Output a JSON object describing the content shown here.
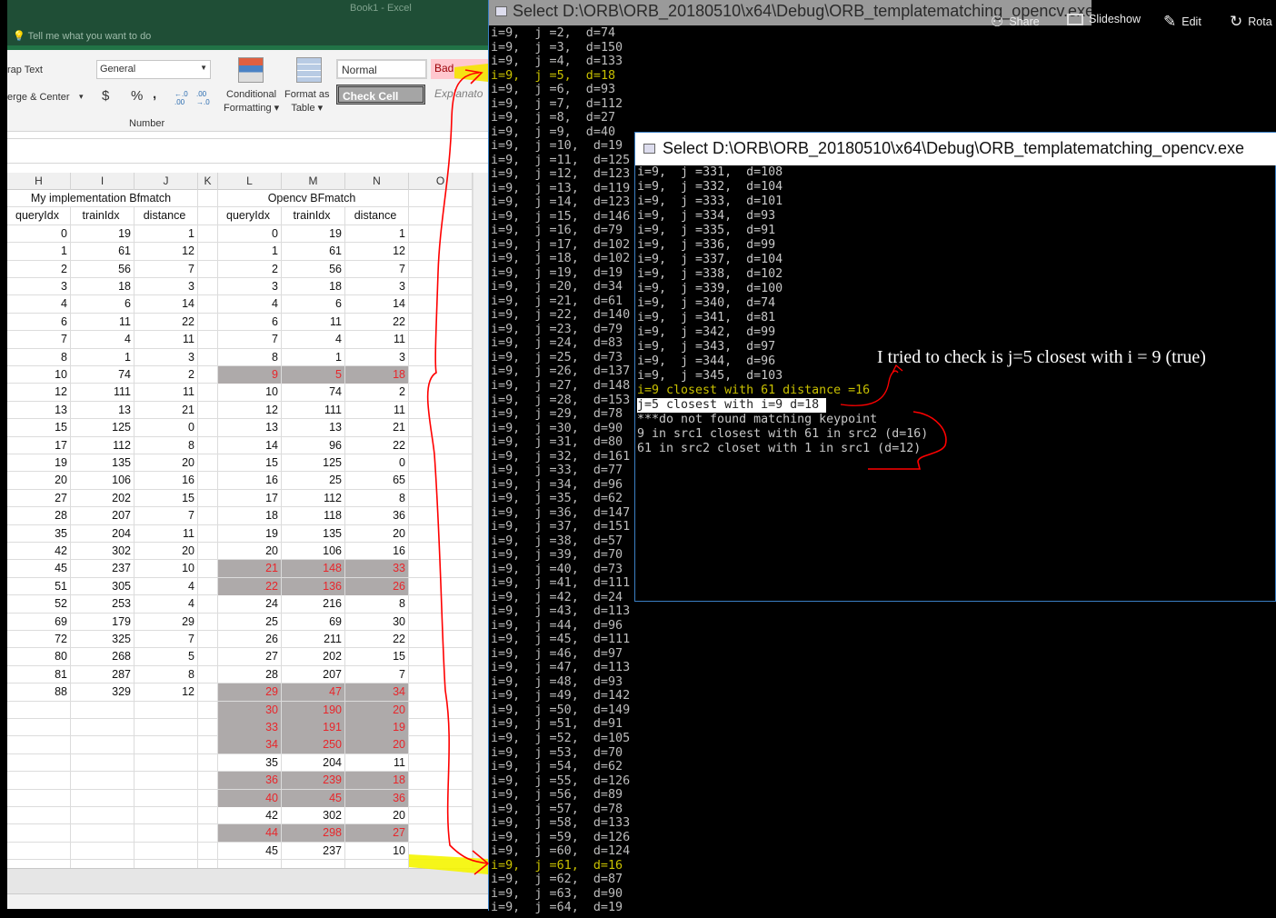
{
  "excel": {
    "title": "Book1  -  Excel",
    "tell_me": "Tell me what you want to do",
    "ribbon": {
      "wrap_text": "rap Text",
      "merge_center": "erge & Center",
      "number_format": "General",
      "currency": "$",
      "percent": "%",
      "comma": ",",
      "inc_decimal": "←.0 .00",
      "dec_decimal": ".00 →.0",
      "number_group": "Number",
      "conditional_formatting": [
        "Conditional",
        "Formatting ▾"
      ],
      "format_as_table": [
        "Format as",
        "Table ▾"
      ],
      "styles": {
        "normal": "Normal",
        "bad": "Bad",
        "check_cell": "Check Cell",
        "explanatory": "Explanato"
      }
    },
    "columns": [
      "H",
      "I",
      "J",
      "K",
      "L",
      "M",
      "N",
      "O"
    ],
    "left_title": "My implementation Bfmatch",
    "right_title": "Opencv BFmatch",
    "headers": [
      "queryIdx",
      "trainIdx",
      "distance"
    ],
    "highlight_color": "#aeaaaa",
    "highlight_text_color": "#e8262b",
    "left_rows": [
      [
        0,
        19,
        1
      ],
      [
        1,
        61,
        12
      ],
      [
        2,
        56,
        7
      ],
      [
        3,
        18,
        3
      ],
      [
        4,
        6,
        14
      ],
      [
        6,
        11,
        22
      ],
      [
        7,
        4,
        11
      ],
      [
        8,
        1,
        3
      ],
      [
        10,
        74,
        2
      ],
      [
        12,
        111,
        11
      ],
      [
        13,
        13,
        21
      ],
      [
        15,
        125,
        0
      ],
      [
        17,
        112,
        8
      ],
      [
        19,
        135,
        20
      ],
      [
        20,
        106,
        16
      ],
      [
        27,
        202,
        15
      ],
      [
        28,
        207,
        7
      ],
      [
        35,
        204,
        11
      ],
      [
        42,
        302,
        20
      ],
      [
        45,
        237,
        10
      ],
      [
        51,
        305,
        4
      ],
      [
        52,
        253,
        4
      ],
      [
        69,
        179,
        29
      ],
      [
        72,
        325,
        7
      ],
      [
        80,
        268,
        5
      ],
      [
        81,
        287,
        8
      ],
      [
        88,
        329,
        12
      ]
    ],
    "right_rows": [
      {
        "v": [
          0,
          19,
          1
        ]
      },
      {
        "v": [
          1,
          61,
          12
        ]
      },
      {
        "v": [
          2,
          56,
          7
        ]
      },
      {
        "v": [
          3,
          18,
          3
        ]
      },
      {
        "v": [
          4,
          6,
          14
        ]
      },
      {
        "v": [
          6,
          11,
          22
        ]
      },
      {
        "v": [
          7,
          4,
          11
        ]
      },
      {
        "v": [
          8,
          1,
          3
        ]
      },
      {
        "v": [
          9,
          5,
          18
        ],
        "highlight": true
      },
      {
        "v": [
          10,
          74,
          2
        ]
      },
      {
        "v": [
          12,
          111,
          11
        ]
      },
      {
        "v": [
          13,
          13,
          21
        ]
      },
      {
        "v": [
          14,
          96,
          22
        ]
      },
      {
        "v": [
          15,
          125,
          0
        ]
      },
      {
        "v": [
          16,
          25,
          65
        ]
      },
      {
        "v": [
          17,
          112,
          8
        ]
      },
      {
        "v": [
          18,
          118,
          36
        ]
      },
      {
        "v": [
          19,
          135,
          20
        ]
      },
      {
        "v": [
          20,
          106,
          16
        ]
      },
      {
        "v": [
          21,
          148,
          33
        ],
        "highlight": true
      },
      {
        "v": [
          22,
          136,
          26
        ],
        "highlight": true
      },
      {
        "v": [
          24,
          216,
          8
        ]
      },
      {
        "v": [
          25,
          69,
          30
        ]
      },
      {
        "v": [
          26,
          211,
          22
        ]
      },
      {
        "v": [
          27,
          202,
          15
        ]
      },
      {
        "v": [
          28,
          207,
          7
        ]
      },
      {
        "v": [
          29,
          47,
          34
        ],
        "highlight": true
      },
      {
        "v": [
          30,
          190,
          20
        ],
        "highlight": true
      },
      {
        "v": [
          33,
          191,
          19
        ],
        "highlight": true
      },
      {
        "v": [
          34,
          250,
          20
        ],
        "highlight": true
      },
      {
        "v": [
          35,
          204,
          11
        ]
      },
      {
        "v": [
          36,
          239,
          18
        ],
        "highlight": true
      },
      {
        "v": [
          40,
          45,
          36
        ],
        "highlight": true
      },
      {
        "v": [
          42,
          302,
          20
        ]
      },
      {
        "v": [
          44,
          298,
          27
        ],
        "highlight": true
      },
      {
        "v": [
          45,
          237,
          10
        ]
      }
    ]
  },
  "console1": {
    "title": "Select D:\\ORB\\ORB_20180510\\x64\\Debug\\ORB_templatematching_opencv.exe",
    "highlight_color": "#c8c000",
    "lines": [
      {
        "j": 2,
        "d": 74
      },
      {
        "j": 3,
        "d": 150
      },
      {
        "j": 4,
        "d": 133
      },
      {
        "j": 5,
        "d": 18,
        "highlight": true
      },
      {
        "j": 6,
        "d": 93
      },
      {
        "j": 7,
        "d": 112
      },
      {
        "j": 8,
        "d": 27
      },
      {
        "j": 9,
        "d": 40
      },
      {
        "j": 10,
        "d": 19
      },
      {
        "j": 11,
        "d": 125
      },
      {
        "j": 12,
        "d": 123
      },
      {
        "j": 13,
        "d": 119
      },
      {
        "j": 14,
        "d": 123
      },
      {
        "j": 15,
        "d": 146
      },
      {
        "j": 16,
        "d": 79
      },
      {
        "j": 17,
        "d": 102
      },
      {
        "j": 18,
        "d": 102
      },
      {
        "j": 19,
        "d": 19
      },
      {
        "j": 20,
        "d": 34
      },
      {
        "j": 21,
        "d": 61
      },
      {
        "j": 22,
        "d": 140
      },
      {
        "j": 23,
        "d": 79
      },
      {
        "j": 24,
        "d": 83
      },
      {
        "j": 25,
        "d": 73
      },
      {
        "j": 26,
        "d": 137
      },
      {
        "j": 27,
        "d": 148
      },
      {
        "j": 28,
        "d": 153
      },
      {
        "j": 29,
        "d": 78
      },
      {
        "j": 30,
        "d": 90
      },
      {
        "j": 31,
        "d": 80
      },
      {
        "j": 32,
        "d": 161
      },
      {
        "j": 33,
        "d": 77
      },
      {
        "j": 34,
        "d": 96
      },
      {
        "j": 35,
        "d": 62
      },
      {
        "j": 36,
        "d": 147
      },
      {
        "j": 37,
        "d": 151
      },
      {
        "j": 38,
        "d": 57
      },
      {
        "j": 39,
        "d": 70
      },
      {
        "j": 40,
        "d": 73
      },
      {
        "j": 41,
        "d": 111
      },
      {
        "j": 42,
        "d": 24
      },
      {
        "j": 43,
        "d": 113
      },
      {
        "j": 44,
        "d": 96
      },
      {
        "j": 45,
        "d": 111
      },
      {
        "j": 46,
        "d": 97
      },
      {
        "j": 47,
        "d": 113
      },
      {
        "j": 48,
        "d": 93
      },
      {
        "j": 49,
        "d": 142
      },
      {
        "j": 50,
        "d": 149
      },
      {
        "j": 51,
        "d": 91
      },
      {
        "j": 52,
        "d": 105
      },
      {
        "j": 53,
        "d": 70
      },
      {
        "j": 54,
        "d": 62
      },
      {
        "j": 55,
        "d": 126
      },
      {
        "j": 56,
        "d": 89
      },
      {
        "j": 57,
        "d": 78
      },
      {
        "j": 58,
        "d": 133
      },
      {
        "j": 59,
        "d": 126
      },
      {
        "j": 60,
        "d": 124
      },
      {
        "j": 61,
        "d": 16,
        "highlight": true
      },
      {
        "j": 62,
        "d": 87
      },
      {
        "j": 63,
        "d": 90
      },
      {
        "j": 64,
        "d": 19
      }
    ]
  },
  "console2": {
    "title": "Select D:\\ORB\\ORB_20180510\\x64\\Debug\\ORB_templatematching_opencv.exe",
    "lines": [
      {
        "j": 331,
        "d": 108
      },
      {
        "j": 332,
        "d": 104
      },
      {
        "j": 333,
        "d": 101
      },
      {
        "j": 334,
        "d": 93
      },
      {
        "j": 335,
        "d": 91
      },
      {
        "j": 336,
        "d": 99
      },
      {
        "j": 337,
        "d": 104
      },
      {
        "j": 338,
        "d": 102
      },
      {
        "j": 339,
        "d": 100
      },
      {
        "j": 340,
        "d": 74
      },
      {
        "j": 341,
        "d": 81
      },
      {
        "j": 342,
        "d": 99
      },
      {
        "j": 343,
        "d": 97
      },
      {
        "j": 344,
        "d": 96
      },
      {
        "j": 345,
        "d": 103
      }
    ],
    "result_yellow": "i=9 closest with 61 distance =16",
    "result_selected": "j=5 closest with i=9 d=18 ",
    "messages": [
      "***do not found matching keypoint",
      "9 in src1 closest with 61 in src2 (d=16)",
      "61 in src2 closet with 1 in src1 (d=12)"
    ]
  },
  "photos_toolbar": {
    "share": "Share",
    "slideshow": "Slideshow",
    "edit": "Edit",
    "rotate": "Rota"
  },
  "annotation": "I tried to check is j=5 closest with i = 9 (true)",
  "annotation_color": "#ff0000"
}
